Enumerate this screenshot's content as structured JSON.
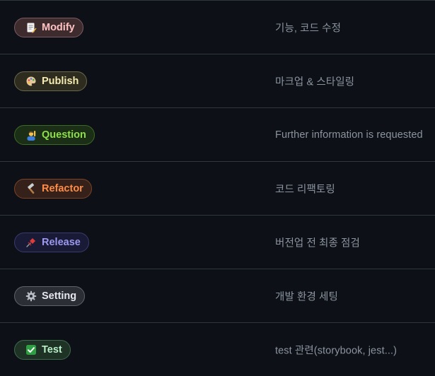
{
  "labels": [
    {
      "name": "Modify",
      "description": "기능, 코드 수정",
      "icon": "memo-icon",
      "text_color": "#ffc2c2",
      "bg_color": "#3d2b2e",
      "border_color": "#7a5a5f"
    },
    {
      "name": "Publish",
      "description": "마크업 & 스타일링",
      "icon": "artist-palette-icon",
      "text_color": "#f5ebb0",
      "bg_color": "#2e2c1f",
      "border_color": "#6b674a"
    },
    {
      "name": "Question",
      "description": "Further information is requested",
      "icon": "person-raising-hand-icon",
      "text_color": "#8ee04a",
      "bg_color": "#1b2e16",
      "border_color": "#3c6b24"
    },
    {
      "name": "Refactor",
      "description": "코드 리팩토링",
      "icon": "hammer-icon",
      "text_color": "#ff8b45",
      "bg_color": "#35211a",
      "border_color": "#7a4326"
    },
    {
      "name": "Release",
      "description": "버전업 전 최종 점검",
      "icon": "pushpin-icon",
      "text_color": "#9d98f2",
      "bg_color": "#191a35",
      "border_color": "#3b3a6e"
    },
    {
      "name": "Setting",
      "description": "개발 환경 세팅",
      "icon": "gear-icon",
      "text_color": "#e6e6ee",
      "bg_color": "#2b2e35",
      "border_color": "#5f636b"
    },
    {
      "name": "Test",
      "description": "test 관련(storybook, jest...)",
      "icon": "check-mark-button-icon",
      "text_color": "#b9efc8",
      "bg_color": "#1e3325",
      "border_color": "#3f6a4b"
    }
  ]
}
